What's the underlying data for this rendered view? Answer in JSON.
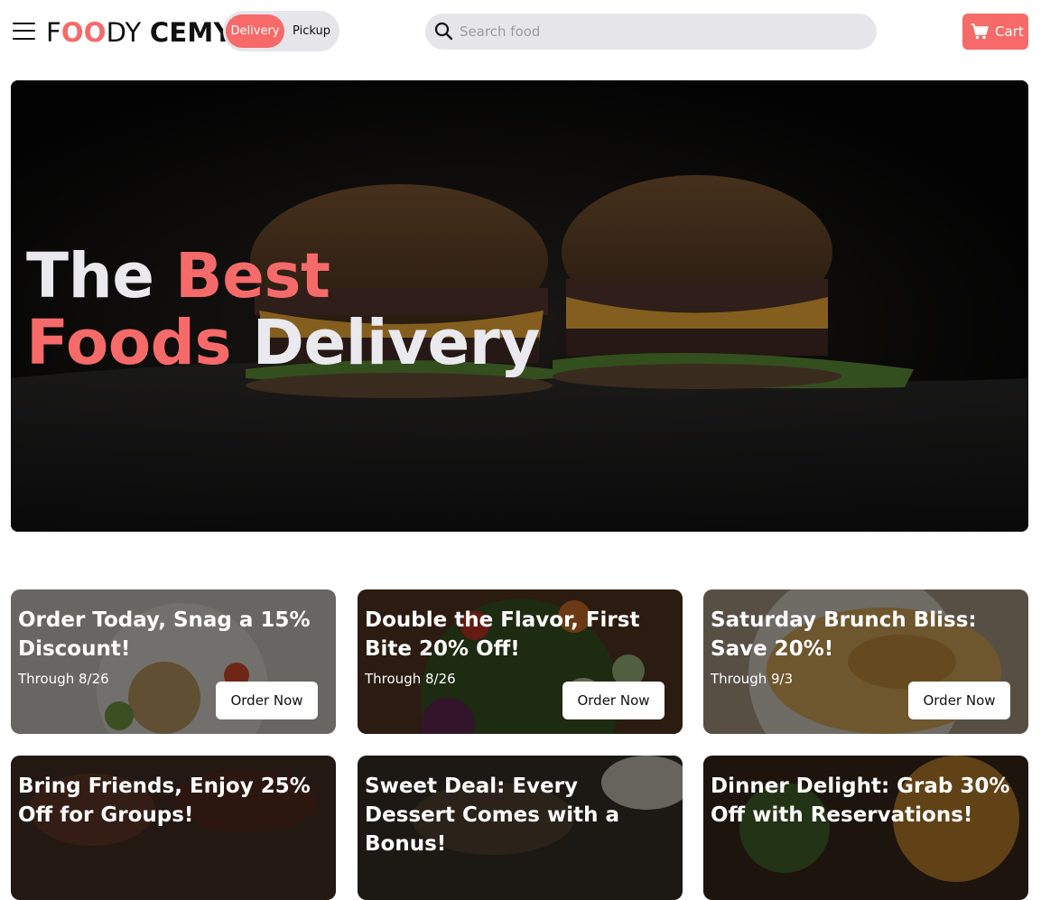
{
  "header": {
    "logo": {
      "part1": "F",
      "part2": "OO",
      "part3": "DY",
      "part4": "CEMY"
    },
    "toggle": {
      "delivery": "Delivery",
      "pickup": "Pickup",
      "selected": "Delivery"
    },
    "search": {
      "placeholder": "Search food",
      "value": ""
    },
    "cart": {
      "label": "Cart"
    }
  },
  "hero": {
    "line1_a": "The",
    "line1_b": "Best",
    "line2_a": "Foods",
    "line2_b": "Delivery"
  },
  "deals": [
    {
      "title": "Order Today, Snag a 15% Discount!",
      "through": "Through 8/26",
      "button": "Order Now"
    },
    {
      "title": "Double the Flavor, First Bite 20% Off!",
      "through": "Through 8/26",
      "button": "Order Now"
    },
    {
      "title": "Saturday Brunch Bliss: Save 20%!",
      "through": "Through 9/3",
      "button": "Order Now"
    },
    {
      "title": "Bring Friends, Enjoy 25% Off for Groups!",
      "through": "",
      "button": ""
    },
    {
      "title": "Sweet Deal: Every Dessert Comes with a Bonus!",
      "through": "",
      "button": ""
    },
    {
      "title": "Dinner Delight: Grab 30% Off with Reservations!",
      "through": "",
      "button": ""
    }
  ],
  "colors": {
    "accent": "#f66a6a",
    "pill_bg": "#e6e6ea"
  },
  "icons": {
    "menu": "hamburger-icon",
    "search": "search-icon",
    "cart": "cart-icon"
  }
}
